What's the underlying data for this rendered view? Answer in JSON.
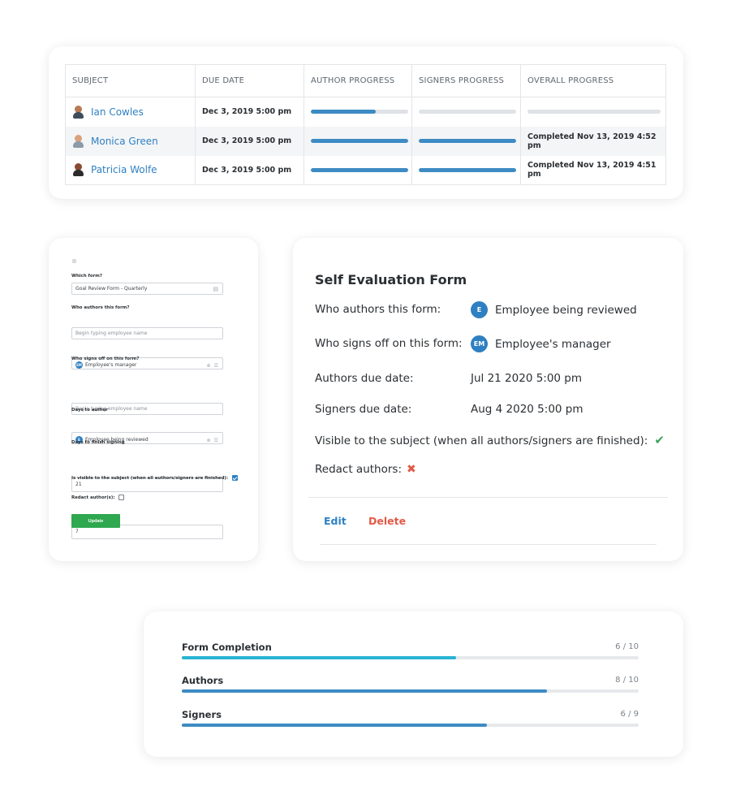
{
  "table": {
    "headers": [
      "SUBJECT",
      "DUE DATE",
      "AUTHOR PROGRESS",
      "SIGNERS PROGRESS",
      "OVERALL PROGRESS"
    ],
    "rows": [
      {
        "subject": "Ian Cowles",
        "due": "Dec 3, 2019 5:00 pm",
        "author_progress": 0.67,
        "signers_progress": 0,
        "overall_progress": 0,
        "overall_text": ""
      },
      {
        "subject": "Monica Green",
        "due": "Dec 3, 2019 5:00 pm",
        "author_progress": 1,
        "signers_progress": 1,
        "overall_text": "Completed Nov 13, 2019 4:52 pm"
      },
      {
        "subject": "Patricia Wolfe",
        "due": "Dec 3, 2019 5:00 pm",
        "author_progress": 1,
        "signers_progress": 1,
        "overall_text": "Completed Nov 13, 2019 4:51 pm"
      }
    ]
  },
  "form": {
    "which_form_label": "Which form?",
    "which_form_value": "Goal Review Form - Quarterly",
    "authors_label": "Who authors this form?",
    "authors_placeholder": "Begin typing employee name",
    "authors_chip_initials": "EM",
    "authors_chip_label": "Employee's manager",
    "signers_label": "Who signs off on this form?",
    "signers_placeholder": "Begin typing employee name",
    "signers_chip_initials": "E",
    "signers_chip_label": "Employee being reviewed",
    "days_author_label": "Days to author",
    "days_author_value": "21",
    "days_sign_label": "Days to finish signing",
    "days_sign_value": "7",
    "visible_label": "Is visible to the subject (when all authors/signers are finished):",
    "visible_checked": true,
    "redact_label": "Redact author(s):",
    "redact_checked": false,
    "update_label": "Update"
  },
  "detail": {
    "title": "Self Evaluation Form",
    "authors_label": "Who authors this form:",
    "authors_initials": "E",
    "authors_value": "Employee being reviewed",
    "signers_label": "Who signs off on this form:",
    "signers_initials": "EM",
    "signers_value": "Employee's manager",
    "authors_due_label": "Authors due date:",
    "authors_due_value": "Jul 21 2020 5:00 pm",
    "signers_due_label": "Signers due date:",
    "signers_due_value": "Aug 4 2020 5:00 pm",
    "visible_label": "Visible to the subject (when all authors/signers are finished):",
    "redact_label": "Redact authors:",
    "edit_label": "Edit",
    "delete_label": "Delete"
  },
  "progress": [
    {
      "label": "Form Completion",
      "count": "6 / 10",
      "value": 0.6,
      "color": "#2ab3d3"
    },
    {
      "label": "Authors",
      "count": "8 / 10",
      "value": 0.8,
      "color": "#3d8bc4"
    },
    {
      "label": "Signers",
      "count": "6 / 9",
      "value": 0.667,
      "color": "#3d8bc4"
    }
  ],
  "colors": {
    "accent_blue": "#2f80c2",
    "progress_blue": "#3d8bc4",
    "success_green": "#2fa84f",
    "danger_red": "#e25a47"
  }
}
